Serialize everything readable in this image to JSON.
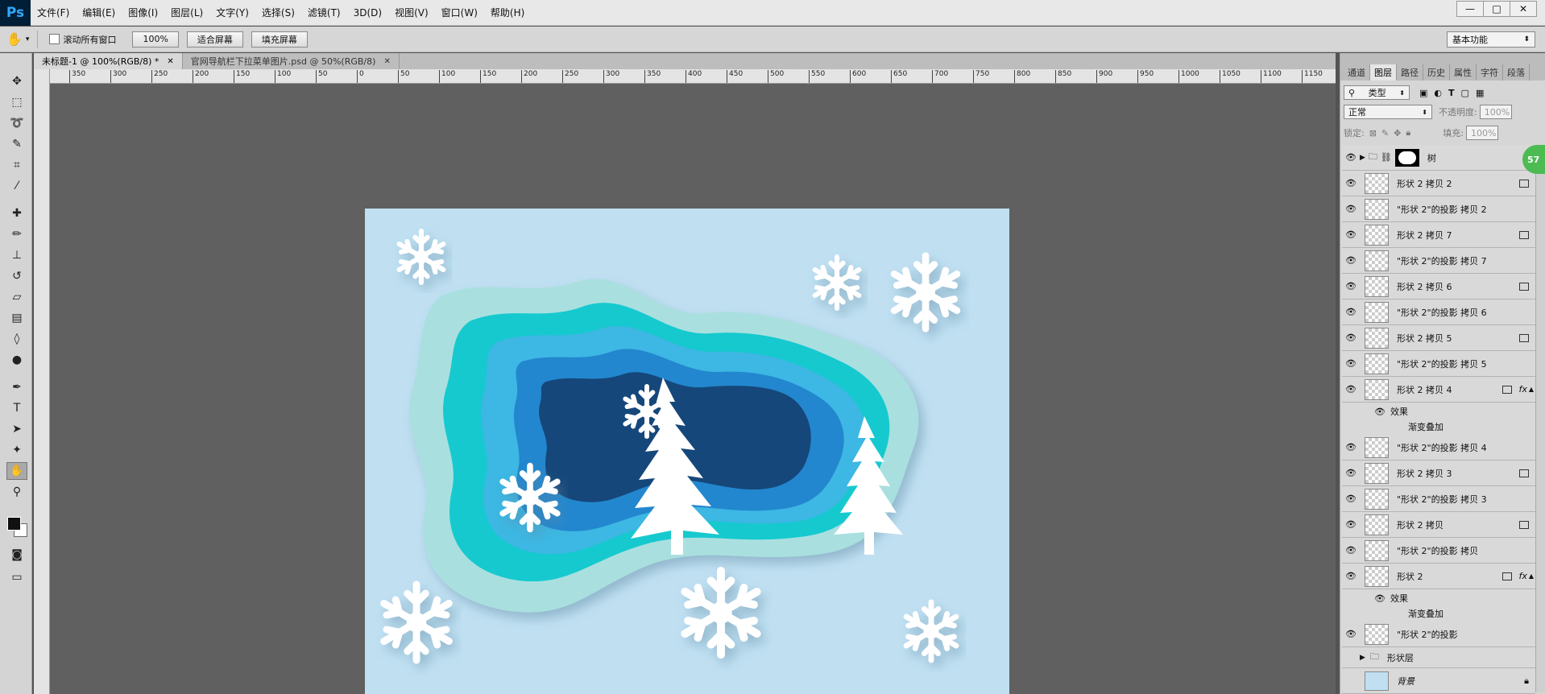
{
  "app": {
    "logo": "Ps"
  },
  "menu": [
    "文件(F)",
    "编辑(E)",
    "图像(I)",
    "图层(L)",
    "文字(Y)",
    "选择(S)",
    "滤镜(T)",
    "3D(D)",
    "视图(V)",
    "窗口(W)",
    "帮助(H)"
  ],
  "window_controls": {
    "minimize": "—",
    "maximize": "□",
    "close": "✕"
  },
  "options": {
    "scroll_all_label": "滚动所有窗口",
    "zoom_value": "100%",
    "fit_screen": "适合屏幕",
    "fill_screen": "填充屏幕",
    "workspace": "基本功能"
  },
  "tabs": [
    {
      "label": "未标题-1 @ 100%(RGB/8) *",
      "close": "✕"
    },
    {
      "label": "官网导航栏下拉菜单图片.psd @ 50%(RGB/8)",
      "close": "✕"
    }
  ],
  "ruler_h": [
    "350",
    "300",
    "250",
    "200",
    "150",
    "100",
    "50",
    "0",
    "50",
    "100",
    "150",
    "200",
    "250",
    "300",
    "350",
    "400",
    "450",
    "500",
    "550",
    "600",
    "650",
    "700",
    "750",
    "800",
    "850",
    "900",
    "950",
    "1000",
    "1050",
    "1100",
    "1150"
  ],
  "panel": {
    "tabs": [
      "通道",
      "图层",
      "路径",
      "历史",
      "属性",
      "字符",
      "段落"
    ],
    "filter_kind": "类型",
    "blend_mode": "正常",
    "opacity_label": "不透明度:",
    "opacity_value": "100%",
    "lock_label": "锁定:",
    "fill_label": "填充:",
    "fill_value": "100%",
    "badge": "57"
  },
  "layers": {
    "group_tree": "树",
    "l1": "形状 2 拷贝 2",
    "l2": "\"形状 2\"的投影 拷贝 2",
    "l3": "形状 2 拷贝 7",
    "l4": "\"形状 2\"的投影 拷贝 7",
    "l5": "形状 2 拷贝 6",
    "l6": "\"形状 2\"的投影 拷贝 6",
    "l7": "形状 2 拷贝 5",
    "l8": "\"形状 2\"的投影 拷贝 5",
    "l9": "形状 2 拷贝 4",
    "effects": "效果",
    "gradient_overlay": "渐变叠加",
    "l10": "\"形状 2\"的投影 拷贝 4",
    "l11": "形状 2 拷贝 3",
    "l12": "\"形状 2\"的投影 拷贝 3",
    "l13": "形状 2 拷贝",
    "l14": "\"形状 2\"的投影 拷贝",
    "l15": "形状 2",
    "l16": "\"形状 2\"的投影",
    "group_shapes": "形状层",
    "background": "背景",
    "fx": "fx"
  }
}
